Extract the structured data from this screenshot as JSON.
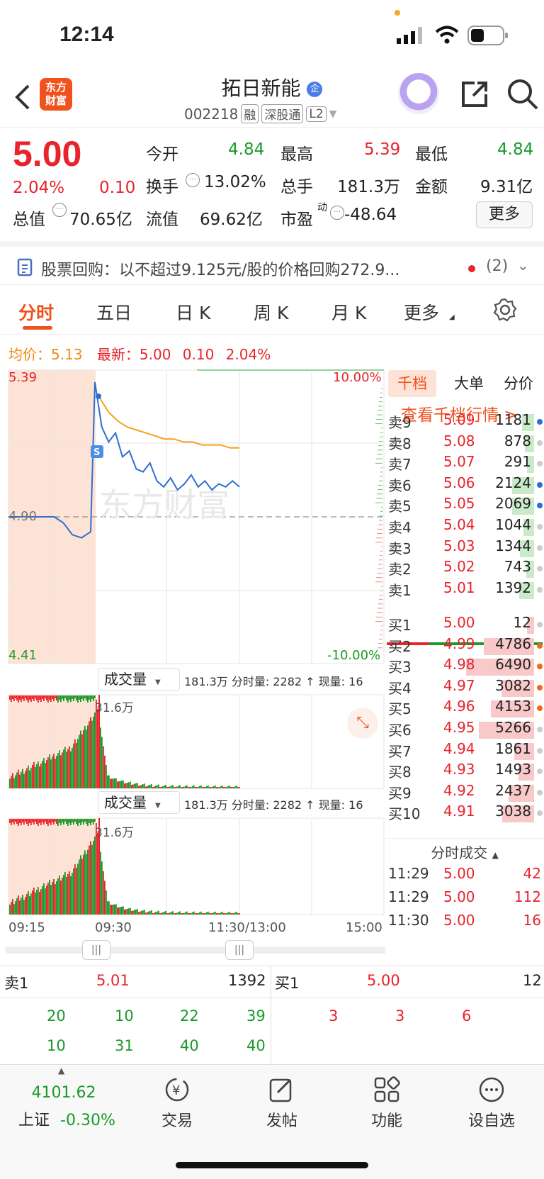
{
  "status": {
    "time": "12:14"
  },
  "header": {
    "back_icon": "chevron-left-icon",
    "logo_text": "东方\n财富",
    "stock_name": "拓日新能",
    "stock_code": "002218",
    "tags": [
      "融",
      "深股通",
      "L2"
    ],
    "badge": "企"
  },
  "quote": {
    "price": "5.00",
    "change_pct": "2.04%",
    "change_amt": "0.10",
    "open_label": "今开",
    "open": "4.84",
    "high_label": "最高",
    "high": "5.39",
    "low_label": "最低",
    "low": "4.84",
    "turnover_label": "换手",
    "turnover": "13.02%",
    "volume_label": "总手",
    "volume": "181.3万",
    "amount_label": "金额",
    "amount": "9.31亿",
    "mcap_label": "总值",
    "mcap": "70.65亿",
    "float_label": "流值",
    "float_cap": "69.62亿",
    "pe_label": "市盈",
    "pe_sup": "动",
    "pe": "-48.64",
    "more_button": "更多"
  },
  "notice": {
    "text": "股票回购：以不超过9.125元/股的价格回购272.9...",
    "count": "(2)"
  },
  "tabs": [
    {
      "label": "分时",
      "active": true
    },
    {
      "label": "五日"
    },
    {
      "label": "日 K"
    },
    {
      "label": "周 K"
    },
    {
      "label": "月 K"
    },
    {
      "label": "更多"
    }
  ],
  "summary": {
    "avg_label": "均价：",
    "avg": "5.13",
    "latest_label": "最新：",
    "latest": "5.00",
    "chg": "0.10",
    "pct": "2.04%"
  },
  "chart": {
    "y_top": "5.39",
    "y_mid": "4.90",
    "y_bot": "4.41",
    "pct_top": "10.00%",
    "pct_bot": "-10.00%",
    "watermark": "东方财富",
    "vol_label": "成交量",
    "vol_info_1": "181.3万 分时量: 2282 ↑ 现量: 16",
    "vol_peak": "31.6万",
    "vol_info_2": "181.3万 分时量: 2282 ↑ 现量: 16",
    "times": [
      "09:15",
      "09:30",
      "11:30/13:00",
      "15:00"
    ]
  },
  "chart_data": {
    "type": "line",
    "ylim": [
      4.41,
      5.39
    ],
    "series": [
      {
        "values": [
          4.9,
          4.9,
          4.9,
          4.9,
          4.9,
          4.9,
          4.88,
          4.84,
          4.83,
          4.85,
          5.35,
          5.2,
          5.15,
          5.18,
          5.1,
          5.12,
          5.06,
          5.05,
          5.08,
          5.02,
          5.0,
          5.03,
          4.99,
          5.01,
          5.04,
          5.0,
          5.02,
          4.99,
          5.01,
          5.0,
          5.02,
          5.0
        ]
      },
      {
        "values": [
          5.3,
          5.25,
          5.22,
          5.2,
          5.19,
          5.18,
          5.17,
          5.16,
          5.16,
          5.15,
          5.15,
          5.14,
          5.14,
          5.14,
          5.13,
          5.13
        ]
      }
    ]
  },
  "book": {
    "tabs": [
      "千档",
      "大单",
      "分价"
    ],
    "link": "查看千档行情 >",
    "asks": [
      {
        "l": "卖9",
        "p": "5.09",
        "v": "1181",
        "c": "#2a6fd6"
      },
      {
        "l": "卖8",
        "p": "5.08",
        "v": "878",
        "c": "#ccc"
      },
      {
        "l": "卖7",
        "p": "5.07",
        "v": "291",
        "c": "#ccc"
      },
      {
        "l": "卖6",
        "p": "5.06",
        "v": "2124",
        "c": "#2a6fd6"
      },
      {
        "l": "卖5",
        "p": "5.05",
        "v": "2069",
        "c": "#2a6fd6"
      },
      {
        "l": "卖4",
        "p": "5.04",
        "v": "1044",
        "c": "#ccc"
      },
      {
        "l": "卖3",
        "p": "5.03",
        "v": "1344",
        "c": "#ccc"
      },
      {
        "l": "卖2",
        "p": "5.02",
        "v": "743",
        "c": "#ccc"
      },
      {
        "l": "卖1",
        "p": "5.01",
        "v": "1392",
        "c": "#ccc"
      }
    ],
    "bids": [
      {
        "l": "买1",
        "p": "5.00",
        "v": "12",
        "c": "#ccc"
      },
      {
        "l": "买2",
        "p": "4.99",
        "v": "4786",
        "c": "#f06a1a"
      },
      {
        "l": "买3",
        "p": "4.98",
        "v": "6490",
        "c": "#f06a1a"
      },
      {
        "l": "买4",
        "p": "4.97",
        "v": "3082",
        "c": "#f06a1a"
      },
      {
        "l": "买5",
        "p": "4.96",
        "v": "4153",
        "c": "#f06a1a"
      },
      {
        "l": "买6",
        "p": "4.95",
        "v": "5266",
        "c": "#ccc"
      },
      {
        "l": "买7",
        "p": "4.94",
        "v": "1861",
        "c": "#ccc"
      },
      {
        "l": "买8",
        "p": "4.93",
        "v": "1493",
        "c": "#ccc"
      },
      {
        "l": "买9",
        "p": "4.92",
        "v": "2437",
        "c": "#ccc"
      },
      {
        "l": "买10",
        "p": "4.91",
        "v": "3038",
        "c": "#ccc"
      }
    ],
    "trades_title": "分时成交",
    "trades": [
      {
        "t": "11:29",
        "p": "5.00",
        "v": "42"
      },
      {
        "t": "11:29",
        "p": "5.00",
        "v": "112"
      },
      {
        "t": "11:30",
        "p": "5.00",
        "v": "16"
      }
    ]
  },
  "bottom": {
    "sell_label": "卖1",
    "sell_price": "5.01",
    "sell_vol": "1392",
    "buy_label": "买1",
    "buy_price": "5.00",
    "buy_vol": "12",
    "sell_q1": [
      "20",
      "10",
      "22",
      "39"
    ],
    "sell_q2": [
      "10",
      "31",
      "40",
      "40"
    ],
    "buy_q1": [
      "3",
      "3",
      "6"
    ]
  },
  "nav": {
    "index_value": "4101.62",
    "index_name": "上证",
    "index_pct": "-0.30%",
    "items": [
      "交易",
      "发帖",
      "功能",
      "设自选"
    ]
  }
}
